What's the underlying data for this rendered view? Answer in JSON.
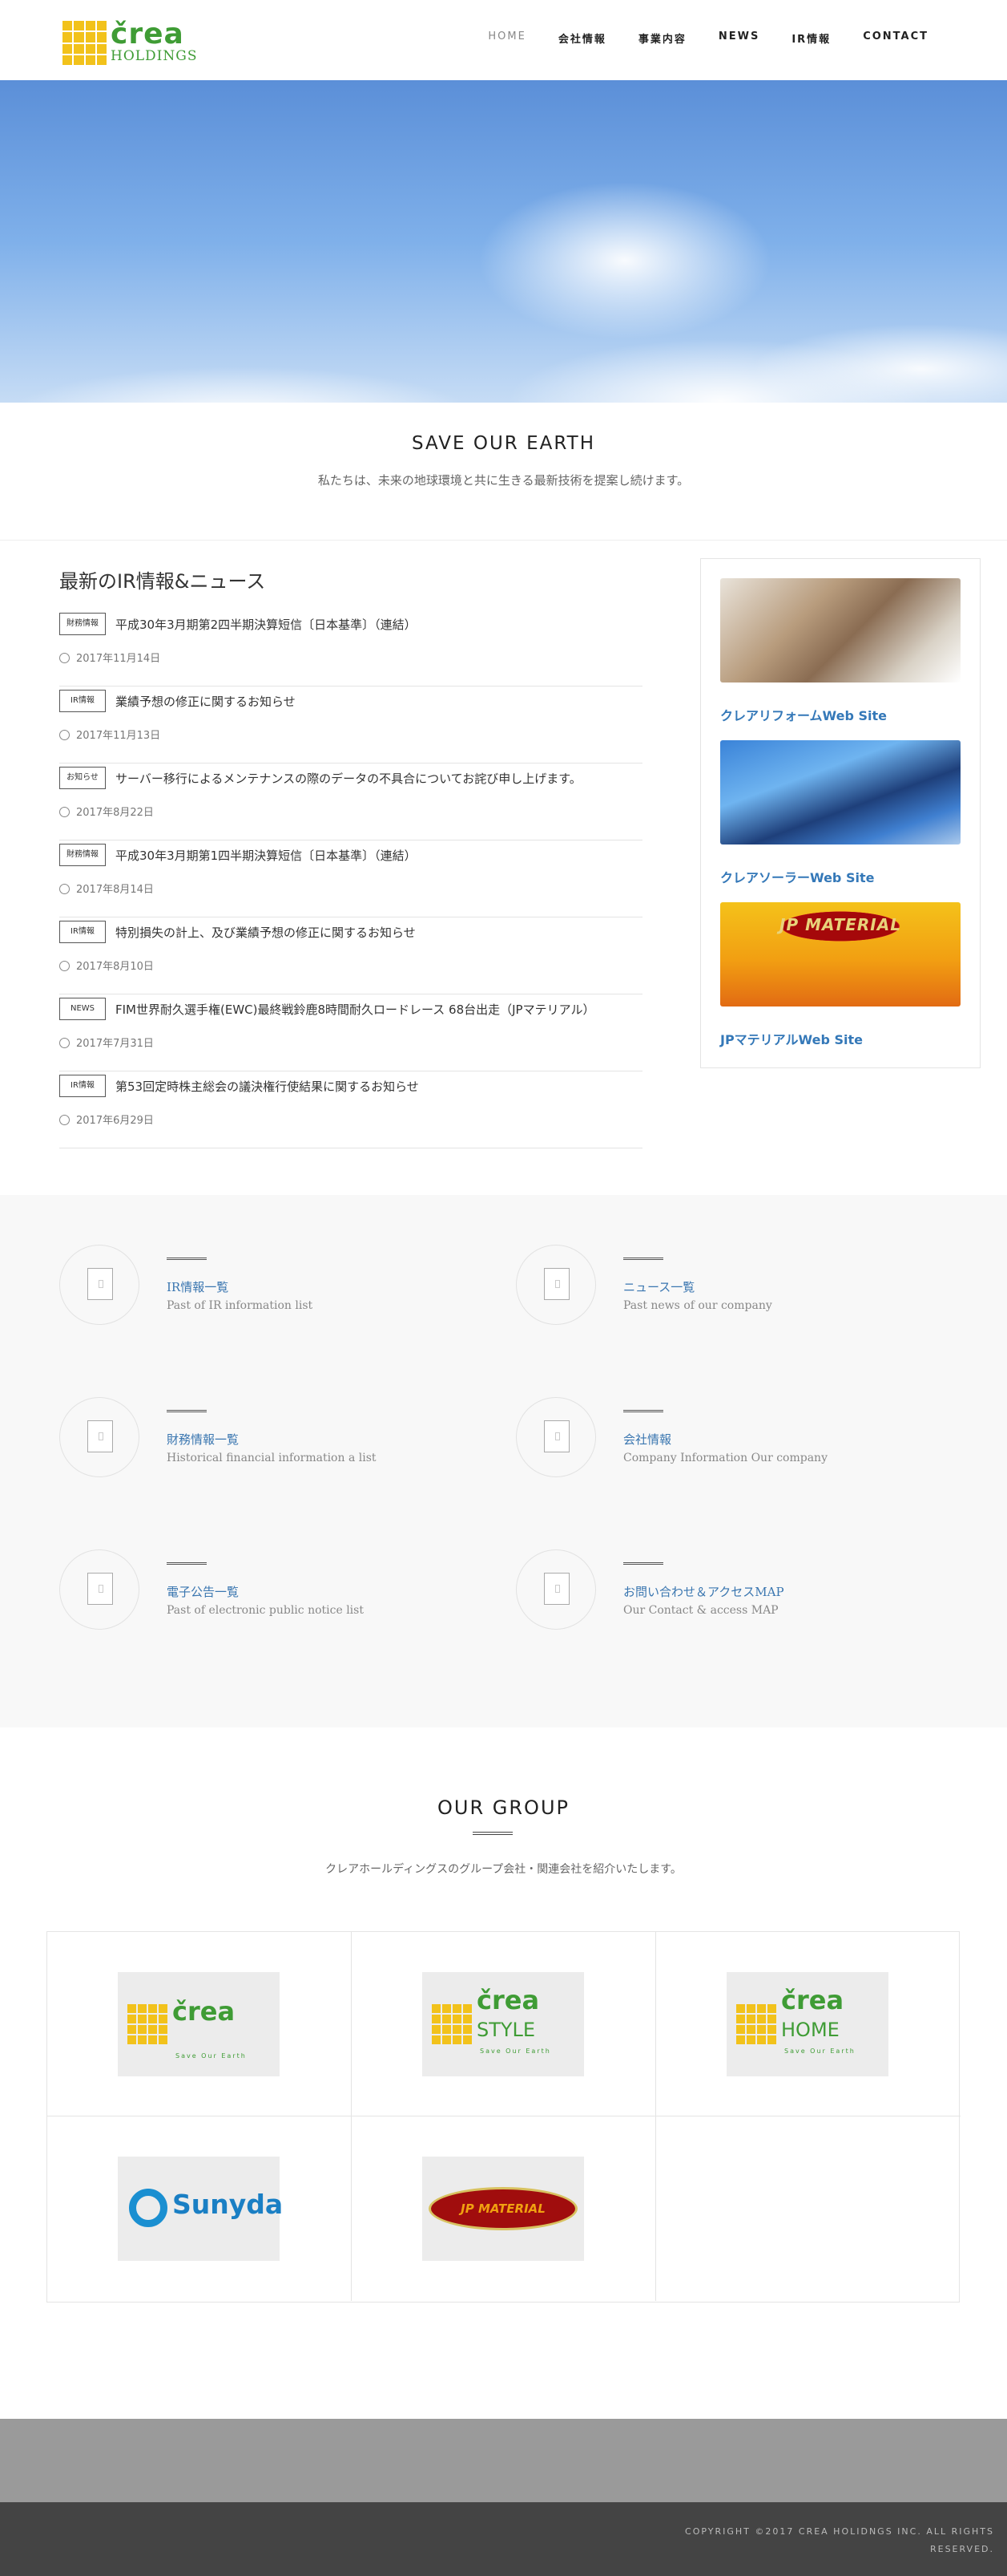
{
  "header": {
    "logo_text": "črea",
    "logo_sub": "HOLDINGS",
    "nav": [
      "HOME",
      "会社情報",
      "事業内容",
      "NEWS",
      "IR情報",
      "CONTACT"
    ]
  },
  "tagline": {
    "title": "SAVE OUR EARTH",
    "text": "私たちは、未来の地球環境と共に生きる最新技術を提案し続けます。"
  },
  "news": {
    "title": "最新のIR情報&ニュース",
    "items": [
      {
        "category": "財務情報",
        "text": "平成30年3月期第2四半期決算短信〔日本基準〕（連結）",
        "date": "2017年11月14日"
      },
      {
        "category": "IR情報",
        "text": "業績予想の修正に関するお知らせ",
        "date": "2017年11月13日"
      },
      {
        "category": "お知らせ",
        "text": "サーバー移行によるメンテナンスの際のデータの不具合についてお詫び申し上げます。",
        "date": "2017年8月22日"
      },
      {
        "category": "財務情報",
        "text": "平成30年3月期第1四半期決算短信〔日本基準〕（連結）",
        "date": "2017年8月14日"
      },
      {
        "category": "IR情報",
        "text": "特別損失の計上、及び業績予想の修正に関するお知らせ",
        "date": "2017年8月10日"
      },
      {
        "category": "NEWS",
        "text": "FIM世界耐久選手権(EWC)最終戦鈴鹿8時間耐久ロードレース 68台出走（JPマテリアル）",
        "date": "2017年7月31日"
      },
      {
        "category": "IR情報",
        "text": "第53回定時株主総会の議決権行使結果に関するお知らせ",
        "date": "2017年6月29日"
      }
    ]
  },
  "sidebar": {
    "sites": [
      {
        "label": "クレアリフォームWeb Site"
      },
      {
        "label": "クレアソーラーWeb Site"
      },
      {
        "label": "JPマテリアルWeb Site",
        "image_text": "JP MATERIAL"
      }
    ]
  },
  "links": [
    {
      "title": "IR情報一覧",
      "sub": "Past of IR information list"
    },
    {
      "title": "ニュース一覧",
      "sub": "Past news of our company"
    },
    {
      "title": "財務情報一覧",
      "sub": "Historical financial information a list"
    },
    {
      "title": "会社情報",
      "sub": "Company Information Our company"
    },
    {
      "title": "電子公告一覧",
      "sub": "Past of electronic public notice list"
    },
    {
      "title": "お問い合わせ＆アクセスMAP",
      "sub": "Our Contact & access MAP"
    }
  ],
  "group": {
    "title": "OUR GROUP",
    "desc": "クレアホールディングスのグループ会社・関連会社を紹介いたします。",
    "logos": [
      {
        "brand": "črea",
        "sub": "",
        "tag": "Save Our Earth"
      },
      {
        "brand": "črea",
        "sub": "STYLE",
        "tag": "Save Our Earth"
      },
      {
        "brand": "črea",
        "sub": "HOME",
        "tag": "Save Our Earth"
      },
      {
        "brand": "Sunyda"
      },
      {
        "brand": "JP MATERIAL"
      }
    ]
  },
  "footer": {
    "copyright": "COPYRIGHT ©2017 CREA HOLIDNGS INC. ALL RIGHTS RESERVED."
  },
  "colors": {
    "brand_green": "#3f9c35",
    "brand_yellow": "#f2c21b",
    "link_blue": "#3a76b0"
  }
}
